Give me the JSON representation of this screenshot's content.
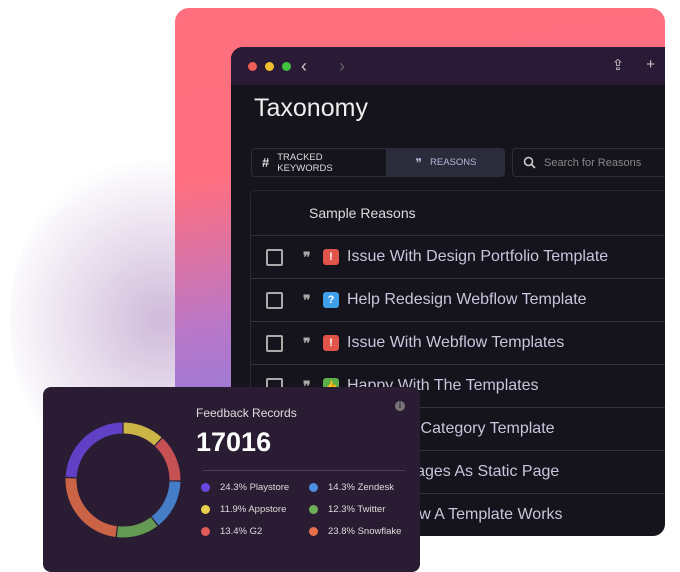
{
  "window": {
    "title": "Taxonomy",
    "back": "‹",
    "forward": "›",
    "share": "⇪",
    "new_tab": "+"
  },
  "tabs": [
    {
      "label": "TRACKED KEYWORDS",
      "icon": "#"
    },
    {
      "label": "REASONS",
      "icon": "❞"
    }
  ],
  "search": {
    "placeholder": "Search for Reasons"
  },
  "table": {
    "header": "Sample Reasons",
    "rows": [
      {
        "text": "Issue With Design Portfolio Template",
        "type": "issue",
        "badge": "!"
      },
      {
        "text": "Help Redesign Webflow Template",
        "type": "question",
        "badge": "?"
      },
      {
        "text": "Issue With Webflow Templates",
        "type": "issue",
        "badge": "!"
      },
      {
        "text": "Happy With The Templates",
        "type": "positive",
        "badge": "👍"
      },
      {
        "text": "ith Linking To Category Template",
        "type": "",
        "badge": ""
      },
      {
        "text": "e Template Pages As Static Page",
        "type": "",
        "badge": ""
      },
      {
        "text": "nderstand How A Template Works",
        "type": "",
        "badge": ""
      }
    ]
  },
  "card": {
    "title": "Feedback Records",
    "total": "17016",
    "info_icon": "i"
  },
  "chart_data": {
    "type": "pie",
    "donut": true,
    "series": [
      {
        "label": "24.3% Playstore",
        "name": "Playstore",
        "value": 24.3,
        "color": "#6a48e0"
      },
      {
        "label": "11.9% Appstore",
        "name": "Appstore",
        "value": 11.9,
        "color": "#e8d04a"
      },
      {
        "label": "13.4% G2",
        "name": "G2",
        "value": 13.4,
        "color": "#e05a5a"
      },
      {
        "label": "14.3% Zendesk",
        "name": "Zendesk",
        "value": 14.3,
        "color": "#4a8ee0"
      },
      {
        "label": "12.3% Twitter",
        "name": "Twitter",
        "value": 12.3,
        "color": "#6eb05a"
      },
      {
        "label": "23.8% Snowflake",
        "name": "Snowflake",
        "value": 23.8,
        "color": "#e8704a"
      }
    ],
    "draw_order": [
      "Appstore",
      "G2",
      "Zendesk",
      "Twitter",
      "Snowflake",
      "Playstore"
    ]
  }
}
